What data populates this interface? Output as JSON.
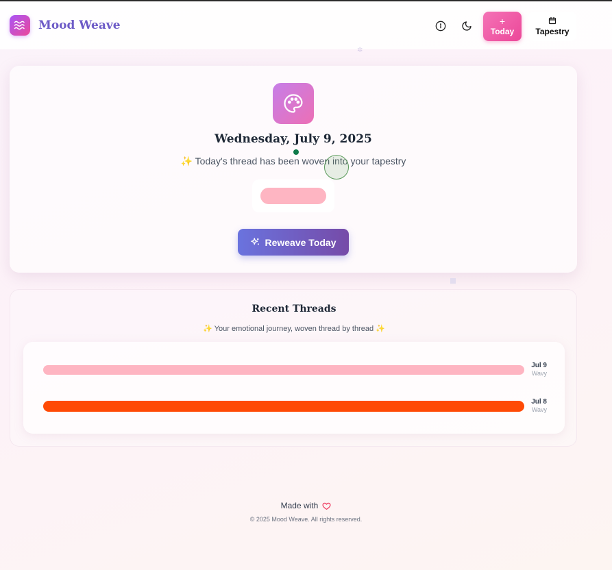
{
  "app": {
    "brand": "Mood Weave"
  },
  "nav": {
    "today_plus": "+",
    "today_label": "Today",
    "tapestry_label": "Tapestry"
  },
  "today": {
    "date": "Wednesday, July 9, 2025",
    "sparkle": "✨",
    "message": "Today's thread has been woven into your tapestry",
    "thread_color": "#feb5c2",
    "reweave_label": "Reweave Today"
  },
  "recent": {
    "title": "Recent Threads",
    "subtitle_sparkle_left": "✨",
    "subtitle": "Your emotional journey, woven thread by thread",
    "subtitle_sparkle_right": "✨",
    "threads": [
      {
        "date": "Jul 9",
        "label": "Wavy",
        "color": "#feb5c2"
      },
      {
        "date": "Jul 8",
        "label": "Wavy",
        "color": "#ff4a05"
      }
    ]
  },
  "footer": {
    "made_with": "Made with",
    "copyright": "© 2025 Mood Weave. All rights reserved."
  },
  "colors": {
    "brand_text": "#6d5bc7",
    "accent_pink": "#ec4899",
    "button_gradient_start": "#6a73de",
    "button_gradient_end": "#764ba8"
  }
}
